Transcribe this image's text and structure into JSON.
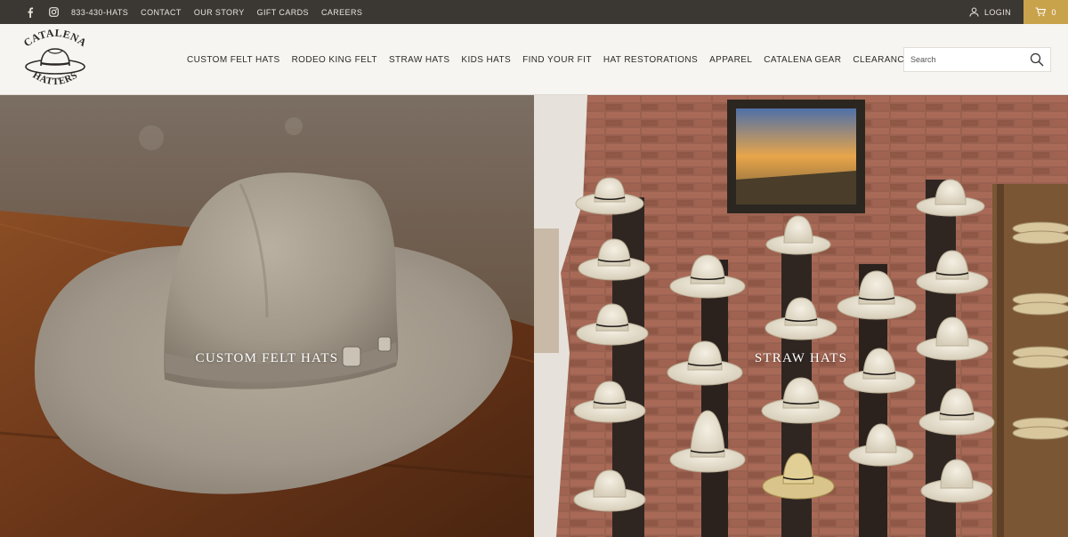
{
  "topbar": {
    "social": [
      "facebook-icon",
      "instagram-icon"
    ],
    "links": [
      "833-430-HATS",
      "CONTACT",
      "OUR STORY",
      "GIFT CARDS",
      "CAREERS"
    ],
    "login_label": "LOGIN",
    "cart_count": "0",
    "colors": {
      "bar": "#3b3733",
      "cart": "#c9a24c"
    }
  },
  "header": {
    "logo": {
      "line1": "CATALENA",
      "line2": "HATTERS"
    },
    "nav": [
      "CUSTOM FELT HATS",
      "RODEO KING FELT",
      "STRAW HATS",
      "KIDS HATS",
      "FIND YOUR FIT",
      "HAT RESTORATIONS",
      "APPAREL",
      "CATALENA GEAR",
      "CLEARANCE"
    ],
    "search": {
      "placeholder": "Search",
      "value": ""
    }
  },
  "hero": {
    "left": {
      "caption": "CUSTOM FELT HATS"
    },
    "right": {
      "caption": "STRAW HATS"
    }
  }
}
